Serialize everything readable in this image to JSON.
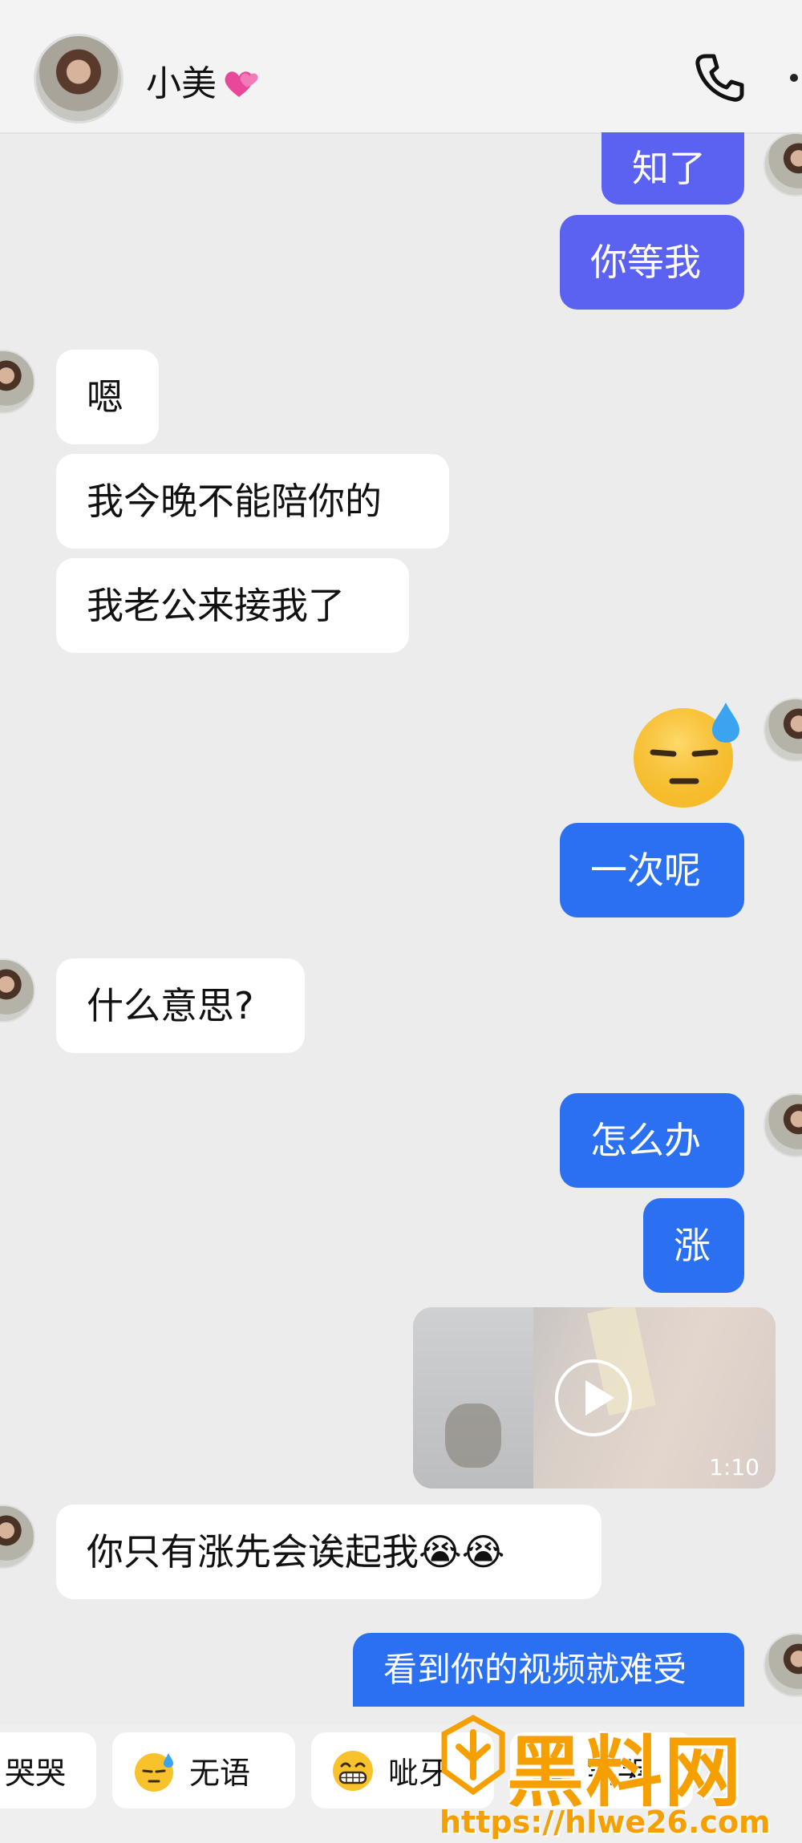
{
  "header": {
    "contact_name": "小美",
    "heart_emoji": "💞"
  },
  "messages": [
    {
      "side": "out",
      "text": "知了"
    },
    {
      "side": "out",
      "text": "你等我"
    },
    {
      "side": "in",
      "text": "嗯"
    },
    {
      "side": "in",
      "text": "我今晚不能陪你的"
    },
    {
      "side": "in",
      "text": "我老公来接我了"
    },
    {
      "side": "out",
      "type": "emoji",
      "text": "😓"
    },
    {
      "side": "out",
      "text": "一次呢"
    },
    {
      "side": "in",
      "text": "什么意思?"
    },
    {
      "side": "out",
      "text": "怎么办"
    },
    {
      "side": "out",
      "text": "涨"
    },
    {
      "side": "out",
      "type": "video",
      "duration": "1:10"
    },
    {
      "side": "in",
      "text": "你只有涨先会诶起我😭😭"
    },
    {
      "side": "out",
      "text": "看到你的视频就难受"
    }
  ],
  "quick_replies": [
    {
      "label": "哭哭",
      "icon": "crying-face-icon"
    },
    {
      "label": "无语",
      "icon": "speechless-face-icon"
    },
    {
      "label": "呲牙",
      "icon": "grinning-face-icon"
    },
    {
      "label": "笑哭",
      "icon": "laughing-face-icon"
    }
  ],
  "watermark": {
    "title": "黑料网",
    "url": "https://hlwe26.com"
  },
  "colors": {
    "bubble_out_purple": "#5b61f1",
    "bubble_out_blue": "#2b70f0",
    "bubble_in": "#ffffff",
    "background": "#ececec",
    "watermark": "#f5a000"
  }
}
